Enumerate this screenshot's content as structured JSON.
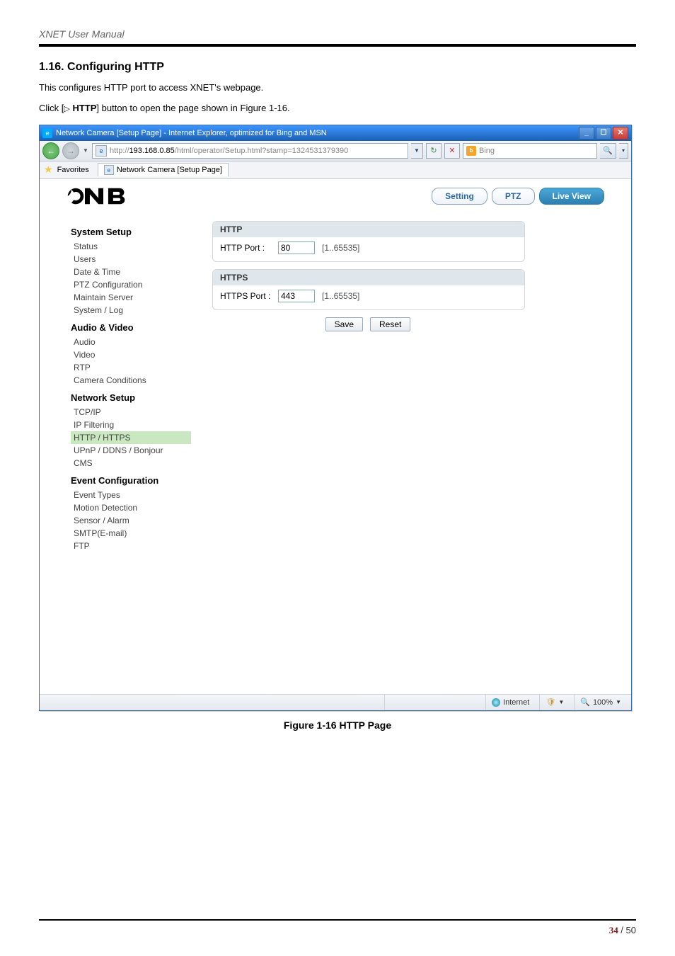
{
  "doc": {
    "title": "XNET User Manual",
    "section_heading": "1.16. Configuring HTTP",
    "intro": "This configures HTTP port to access XNET's webpage.",
    "click_prefix": "Click [",
    "click_icon": "▷",
    "click_bold": " HTTP",
    "click_suffix": "] button to open the page shown in Figure 1-16.",
    "caption": "Figure 1-16 HTTP Page",
    "page_current": "34",
    "page_sep": " / ",
    "page_total": "50"
  },
  "browser": {
    "title": "Network Camera [Setup Page] - Internet Explorer, optimized for Bing and MSN",
    "url_prefix": "http://",
    "url_host": "193.168.0.85",
    "url_path": "/html/operator/Setup.html?stamp=1324531379390",
    "favorites_label": "Favorites",
    "tab_label": "Network Camera [Setup Page]",
    "search_provider": "Bing",
    "status_zone": "Internet",
    "zoom": "100%",
    "winbtns": {
      "min": "_",
      "max": "☐",
      "close": "✕"
    }
  },
  "app": {
    "logo": "CNB",
    "tabs": {
      "setting": "Setting",
      "ptz": "PTZ",
      "live": "Live View"
    },
    "sidebar": {
      "g1": "System Setup",
      "g1_items": [
        "Status",
        "Users",
        "Date & Time",
        "PTZ Configuration",
        "Maintain Server",
        "System / Log"
      ],
      "g2": "Audio & Video",
      "g2_items": [
        "Audio",
        "Video",
        "RTP",
        "Camera Conditions"
      ],
      "g3": "Network Setup",
      "g3_items": [
        "TCP/IP",
        "IP Filtering",
        "HTTP / HTTPS",
        "UPnP / DDNS / Bonjour",
        "CMS"
      ],
      "g4": "Event Configuration",
      "g4_items": [
        "Event Types",
        "Motion Detection",
        "Sensor / Alarm",
        "SMTP(E-mail)",
        "FTP"
      ]
    },
    "http": {
      "panel_title": "HTTP",
      "port_label": "HTTP Port :",
      "port_value": "80",
      "port_range": "[1..65535]"
    },
    "https": {
      "panel_title": "HTTPS",
      "port_label": "HTTPS Port :",
      "port_value": "443",
      "port_range": "[1..65535]"
    },
    "buttons": {
      "save": "Save",
      "reset": "Reset"
    }
  }
}
